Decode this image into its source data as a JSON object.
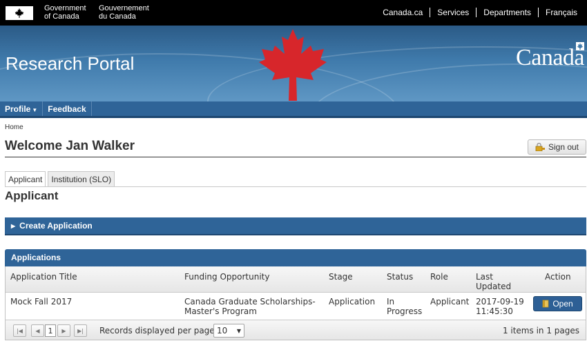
{
  "gov_bar": {
    "gov_en_line1": "Government",
    "gov_en_line2": "of Canada",
    "gov_fr_line1": "Gouvernement",
    "gov_fr_line2": "du Canada",
    "links": [
      "Canada.ca",
      "Services",
      "Departments",
      "Français"
    ]
  },
  "banner": {
    "title": "Research Portal",
    "wordmark": "Canada"
  },
  "menu": {
    "items": [
      "Profile",
      "Feedback"
    ]
  },
  "breadcrumb": "Home",
  "page_title": "Welcome Jan Walker",
  "signout_label": "Sign out",
  "tabs": [
    "Applicant",
    "Institution (SLO)"
  ],
  "section_title": "Applicant",
  "create_label": "Create Application",
  "applications": {
    "header": "Applications",
    "columns": {
      "title": "Application Title",
      "funding": "Funding Opportunity",
      "stage": "Stage",
      "status": "Status",
      "role": "Role",
      "updated_1": "Last",
      "updated_2": "Updated",
      "action": "Action"
    },
    "rows": [
      {
        "title": "Mock Fall 2017",
        "funding_1": "Canada Graduate Scholarships-",
        "funding_2": "Master's Program",
        "stage": "Application",
        "status_1": "In",
        "status_2": "Progress",
        "role": "Applicant",
        "updated_1": "2017-09-19",
        "updated_2": "11:45:30",
        "action": "Open"
      }
    ],
    "pager": {
      "current_page": "1",
      "records_label": "Records displayed per page:",
      "per_page": "10",
      "info": "1 items in 1 pages"
    }
  },
  "colors": {
    "nav_blue": "#2f6498",
    "leaf_red": "#d7262b",
    "gov_black": "#000000"
  }
}
